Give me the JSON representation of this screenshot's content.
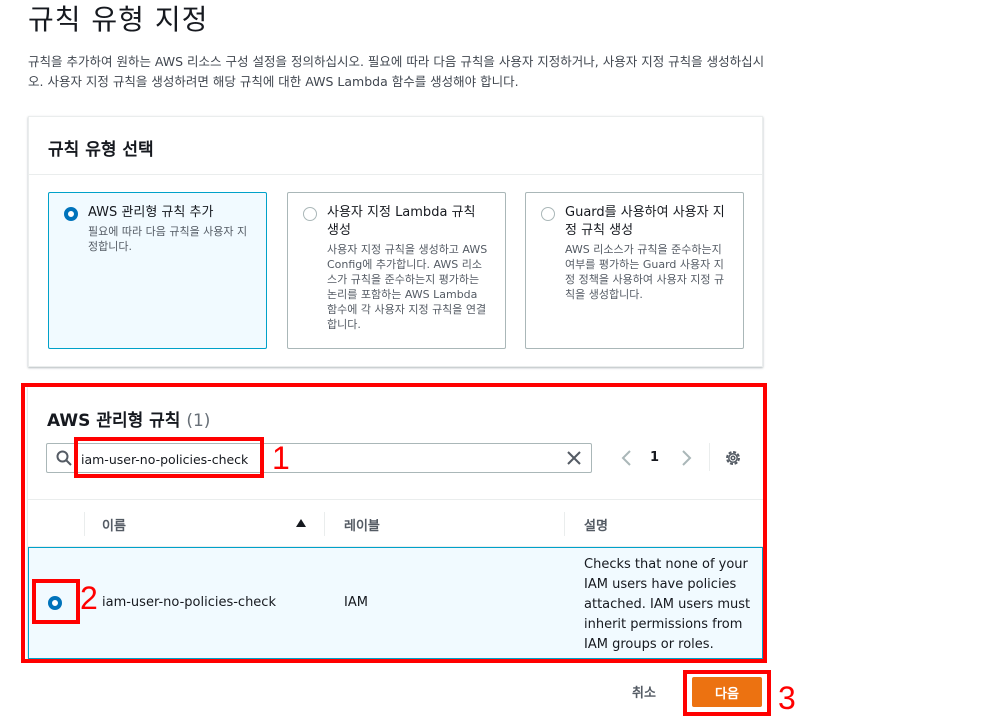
{
  "page": {
    "title": "규칙 유형 지정",
    "description": "규칙을 추가하여 원하는 AWS 리소스 구성 설정을 정의하십시오. 필요에 따라 다음 규칙을 사용자 지정하거나, 사용자 지정 규칙을 생성하십시오. 사용자 지정 규칙을 생성하려면 해당 규칙에 대한 AWS Lambda 함수를 생성해야 합니다."
  },
  "rule_type": {
    "title": "규칙 유형 선택",
    "options": [
      {
        "label": "AWS 관리형 규칙 추가",
        "description": "필요에 따라 다음 규칙을 사용자 지정합니다.",
        "selected": true
      },
      {
        "label": "사용자 지정 Lambda 규칙 생성",
        "description": "사용자 지정 규칙을 생성하고 AWS Config에 추가합니다. AWS 리소스가 규칙을 준수하는지 평가하는 논리를 포함하는 AWS Lambda 함수에 각 사용자 지정 규칙을 연결합니다.",
        "selected": false
      },
      {
        "label": "Guard를 사용하여 사용자 지정 규칙 생성",
        "description": "AWS 리소스가 규칙을 준수하는지 여부를 평가하는 Guard 사용자 지정 정책을 사용하여 사용자 지정 규칙을 생성합니다.",
        "selected": false
      }
    ]
  },
  "managed_rules": {
    "title": "AWS 관리형 규칙",
    "count": "(1)",
    "search_value": "iam-user-no-policies-check",
    "page_number": "1",
    "columns": {
      "name": "이름",
      "label": "레이블",
      "description": "설명"
    },
    "rows": [
      {
        "name": "iam-user-no-policies-check",
        "label": "IAM",
        "description": "Checks that none of your IAM users have policies attached. IAM users must inherit permissions from IAM groups or roles.",
        "selected": true
      }
    ]
  },
  "actions": {
    "cancel": "취소",
    "next": "다음"
  },
  "annotations": {
    "step1": "1",
    "step2": "2",
    "step3": "3"
  },
  "colors": {
    "primary_button": "#ec7211",
    "selected_border": "#00a1c9",
    "selected_bg": "#f1faff",
    "radio_selected": "#0073bb",
    "annotation": "#ff0000"
  },
  "icons": {
    "search": "search-icon",
    "clear": "close-icon",
    "prev": "chevron-left-icon",
    "next": "chevron-right-icon",
    "settings": "gear-icon",
    "sort": "sort-ascending-icon"
  }
}
